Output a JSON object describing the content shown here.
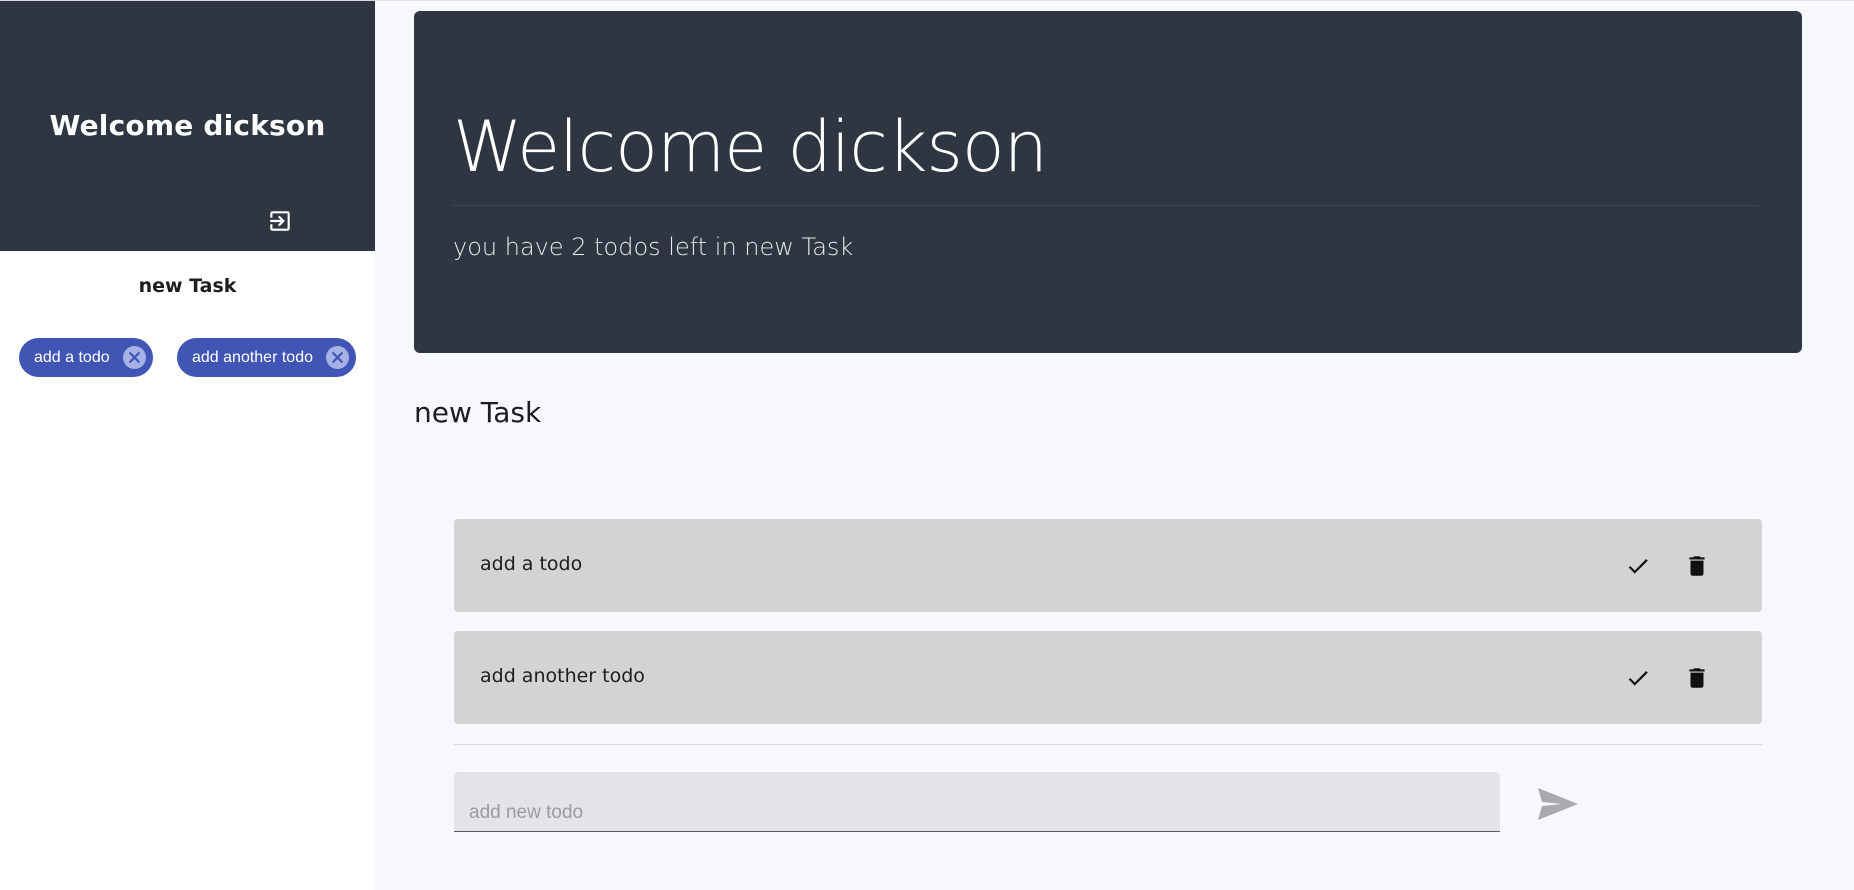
{
  "sidebar": {
    "title": "Welcome dickson",
    "logout_icon": "logout-icon",
    "task_name": "new Task",
    "chips": [
      {
        "label": "add a todo",
        "icon": "close-circle-icon"
      },
      {
        "label": "add another todo",
        "icon": "close-circle-icon"
      }
    ]
  },
  "jumbotron": {
    "title": "Welcome dickson",
    "subtitle": "you have 2 todos left in new Task"
  },
  "main": {
    "task_heading": "new Task",
    "todos": [
      {
        "text": "add a todo",
        "check_icon": "check-icon",
        "delete_icon": "trash-icon"
      },
      {
        "text": "add another todo",
        "check_icon": "check-icon",
        "delete_icon": "trash-icon"
      }
    ],
    "new_todo": {
      "placeholder": "add new todo",
      "value": ""
    },
    "send_icon": "send-icon"
  },
  "colors": {
    "dark_header": "#2f3541",
    "chip": "#4155b5",
    "chip_close": "#a6b2e6",
    "todo_bg": "#d3d3d3",
    "page_bg": "#f7f8fc",
    "input_bg": "#e3e3e8"
  }
}
